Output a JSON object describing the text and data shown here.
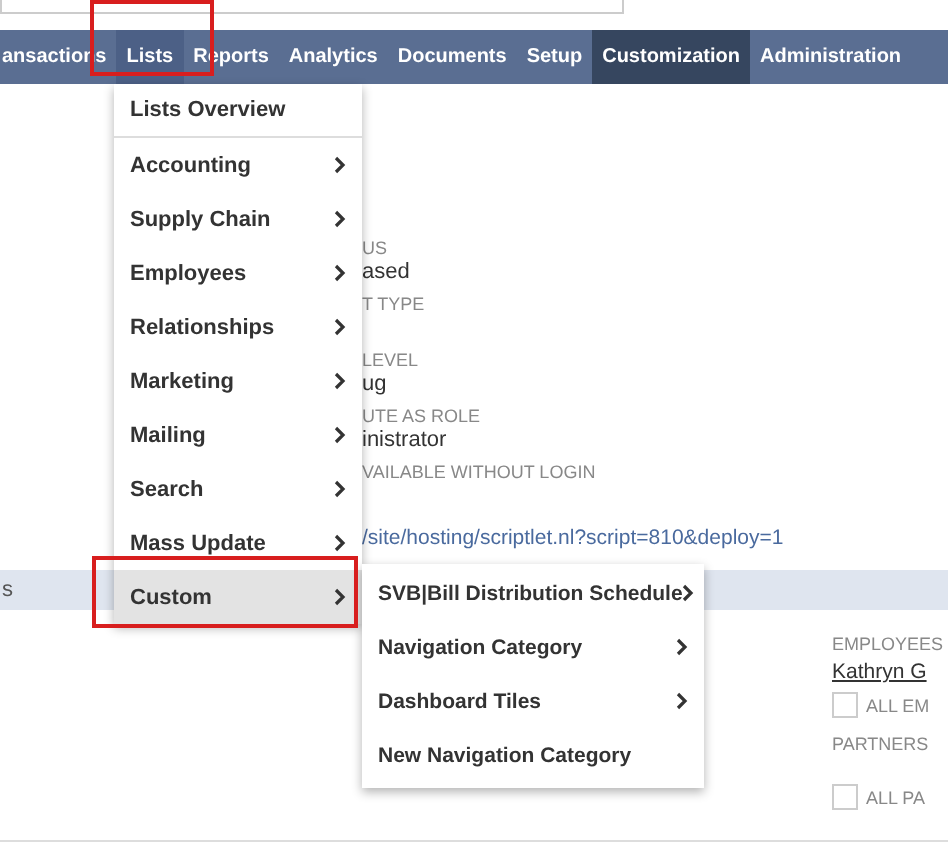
{
  "nav": [
    {
      "label": "ansactions",
      "selected": false,
      "expanded": false
    },
    {
      "label": "Lists",
      "selected": false,
      "expanded": true
    },
    {
      "label": "Reports",
      "selected": false,
      "expanded": false
    },
    {
      "label": "Analytics",
      "selected": false,
      "expanded": false
    },
    {
      "label": "Documents",
      "selected": false,
      "expanded": false
    },
    {
      "label": "Setup",
      "selected": false,
      "expanded": false
    },
    {
      "label": "Customization",
      "selected": true,
      "expanded": false
    },
    {
      "label": "Administration",
      "selected": false,
      "expanded": false
    }
  ],
  "record": {
    "fields": [
      {
        "label": "US",
        "value": "ased"
      },
      {
        "label": "T TYPE"
      },
      {
        "label": "LEVEL",
        "value": "ug"
      },
      {
        "label": "UTE AS ROLE",
        "value": "inistrator"
      },
      {
        "label": "VAILABLE WITHOUT LOGIN"
      }
    ],
    "link": "/site/hosting/scriptlet.nl?script=810&deploy=1"
  },
  "section": {
    "title": "s"
  },
  "audience": {
    "employees_label": "EMPLOYEES",
    "employees_value": "Kathryn G",
    "all_employees": {
      "label": "ALL EM",
      "checked": false
    },
    "partners_label": "PARTNERS",
    "all_partners": {
      "label": "ALL PA",
      "checked": false
    }
  },
  "lists_menu": {
    "items": [
      {
        "label": "Lists Overview",
        "kind": "link",
        "selected": false
      },
      {
        "label": "Accounting",
        "kind": "submenu",
        "selected": false
      },
      {
        "label": "Supply Chain",
        "kind": "submenu",
        "selected": false
      },
      {
        "label": "Employees",
        "kind": "submenu",
        "selected": false
      },
      {
        "label": "Relationships",
        "kind": "submenu",
        "selected": false
      },
      {
        "label": "Marketing",
        "kind": "submenu",
        "selected": false
      },
      {
        "label": "Mailing",
        "kind": "submenu",
        "selected": false
      },
      {
        "label": "Search",
        "kind": "submenu",
        "selected": false
      },
      {
        "label": "Mass Update",
        "kind": "submenu",
        "selected": false
      },
      {
        "label": "Custom",
        "kind": "submenu",
        "selected": true
      }
    ]
  },
  "custom_submenu": {
    "items": [
      {
        "label": "SVB|Bill Distribution Schedule",
        "kind": "submenu",
        "selected": false
      },
      {
        "label": "Navigation Category",
        "kind": "submenu",
        "selected": false
      },
      {
        "label": "Dashboard Tiles",
        "kind": "submenu",
        "selected": false
      },
      {
        "label": "New Navigation Category",
        "kind": "link",
        "selected": false
      }
    ]
  }
}
